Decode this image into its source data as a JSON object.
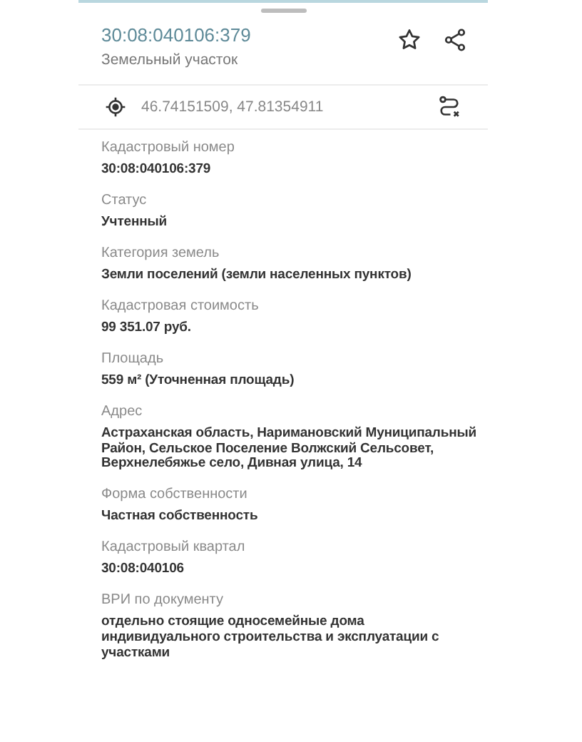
{
  "header": {
    "title": "30:08:040106:379",
    "subtitle": "Земельный участок"
  },
  "coordinates": "46.74151509, 47.81354911",
  "fields": [
    {
      "label": "Кадастровый номер",
      "value": "30:08:040106:379"
    },
    {
      "label": "Статус",
      "value": "Учтенный"
    },
    {
      "label": "Категория земель",
      "value": "Земли поселений (земли населенных пунктов)"
    },
    {
      "label": "Кадастровая стоимость",
      "value": "99 351.07 руб."
    },
    {
      "label": "Площадь",
      "value": "559 м² (Уточненная площадь)"
    },
    {
      "label": "Адрес",
      "value": "Астраханская область, Наримановский Муниципальный Район, Сельское Поселение Волжский Сельсовет, Верхнелебяжье село, Дивная улица, 14"
    },
    {
      "label": "Форма собственности",
      "value": "Частная собственность"
    },
    {
      "label": "Кадастровый квартал",
      "value": "30:08:040106"
    },
    {
      "label": "ВРИ по документу",
      "value": "отдельно стоящие односемейные дома индивидуального строительства и эксплуатации с участками"
    }
  ]
}
